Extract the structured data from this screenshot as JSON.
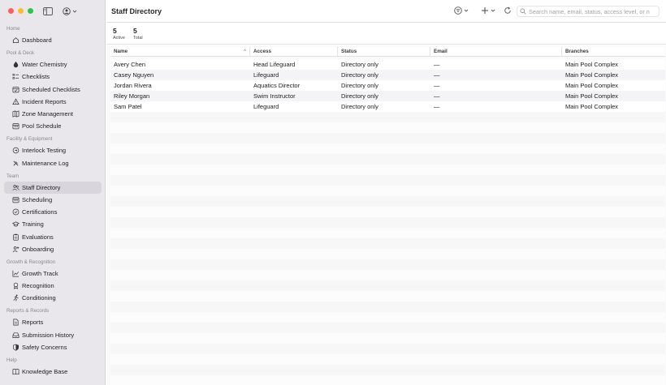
{
  "window": {
    "title": "Staff Directory"
  },
  "sidebar": {
    "sections": [
      {
        "title": "Home",
        "items": [
          {
            "label": "Dashboard",
            "icon": "house-icon"
          }
        ]
      },
      {
        "title": "Pool & Deck",
        "items": [
          {
            "label": "Water Chemistry",
            "icon": "droplet-icon"
          },
          {
            "label": "Checklists",
            "icon": "checklist-icon"
          },
          {
            "label": "Scheduled Checklists",
            "icon": "calendar-check-icon"
          },
          {
            "label": "Incident Reports",
            "icon": "warning-icon"
          },
          {
            "label": "Zone Management",
            "icon": "map-icon"
          },
          {
            "label": "Pool Schedule",
            "icon": "calendar-icon"
          }
        ]
      },
      {
        "title": "Facility & Equipment",
        "items": [
          {
            "label": "Interlock Testing",
            "icon": "interlock-icon"
          },
          {
            "label": "Maintenance Log",
            "icon": "wrench-icon"
          }
        ]
      },
      {
        "title": "Team",
        "items": [
          {
            "label": "Staff Directory",
            "icon": "people-icon",
            "active": true
          },
          {
            "label": "Scheduling",
            "icon": "calendar-icon"
          },
          {
            "label": "Certifications",
            "icon": "seal-check-icon"
          },
          {
            "label": "Training",
            "icon": "graduation-cap-icon"
          },
          {
            "label": "Evaluations",
            "icon": "clipboard-icon"
          },
          {
            "label": "Onboarding",
            "icon": "person-add-icon"
          }
        ]
      },
      {
        "title": "Growth & Recognition",
        "items": [
          {
            "label": "Growth Track",
            "icon": "chart-line-icon"
          },
          {
            "label": "Recognition",
            "icon": "award-icon"
          },
          {
            "label": "Conditioning",
            "icon": "running-icon"
          }
        ]
      },
      {
        "title": "Reports & Records",
        "items": [
          {
            "label": "Reports",
            "icon": "document-icon"
          },
          {
            "label": "Submission History",
            "icon": "tray-icon"
          },
          {
            "label": "Safety Concerns",
            "icon": "shield-icon"
          }
        ]
      },
      {
        "title": "Help",
        "items": [
          {
            "label": "Knowledge Base",
            "icon": "book-icon"
          }
        ]
      }
    ]
  },
  "toolbar": {
    "search_placeholder": "Search name, email, status, access level, or n"
  },
  "stats": [
    {
      "value": "5",
      "label": "Active"
    },
    {
      "value": "5",
      "label": "Total"
    }
  ],
  "table": {
    "columns": [
      "Name",
      "Access",
      "Status",
      "Email",
      "Branches"
    ],
    "sort_indicator": "^",
    "rows": [
      [
        "Avery Chen",
        "Head Lifeguard",
        "Directory only",
        "—",
        "Main Pool Complex"
      ],
      [
        "Casey Nguyen",
        "Lifeguard",
        "Directory only",
        "—",
        "Main Pool Complex"
      ],
      [
        "Jordan Rivera",
        "Aquatics Director",
        "Directory only",
        "—",
        "Main Pool Complex"
      ],
      [
        "Riley Morgan",
        "Swim Instructor",
        "Directory only",
        "—",
        "Main Pool Complex"
      ],
      [
        "Sam Patel",
        "Lifeguard",
        "Directory only",
        "—",
        "Main Pool Complex"
      ]
    ]
  }
}
